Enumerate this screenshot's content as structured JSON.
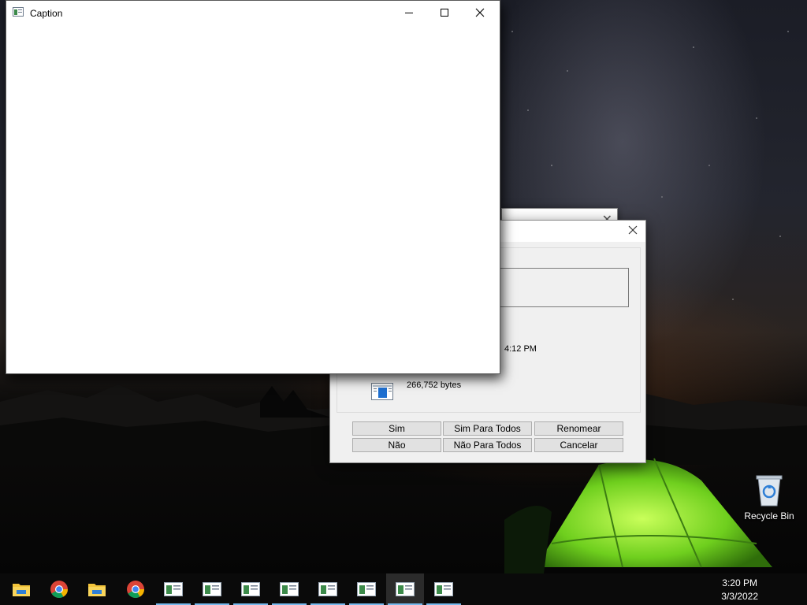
{
  "main_window": {
    "title": "Caption",
    "icons": {
      "app": "window-app-icon",
      "minimize": "minimize-icon",
      "maximize": "maximize-icon",
      "close": "close-icon"
    }
  },
  "dialog": {
    "date_fragment": "4:12 PM",
    "file_size": "266,752 bytes",
    "buttons": {
      "yes": "Sim",
      "yes_to_all": "Sim Para Todos",
      "rename": "Renomear",
      "no": "Não",
      "no_to_all": "Não Para Todos",
      "cancel": "Cancelar"
    }
  },
  "desktop": {
    "recycle_bin_label": "Recycle Bin"
  },
  "taskbar": {
    "items": [
      {
        "icon": "file-explorer-icon"
      },
      {
        "icon": "chrome-icon"
      },
      {
        "icon": "file-explorer-icon"
      },
      {
        "icon": "chrome-icon"
      },
      {
        "icon": "app-window-icon"
      },
      {
        "icon": "app-window-icon"
      },
      {
        "icon": "app-window-icon"
      },
      {
        "icon": "app-window-icon"
      },
      {
        "icon": "app-window-icon"
      },
      {
        "icon": "app-window-icon"
      },
      {
        "icon": "app-window-icon",
        "active": true
      },
      {
        "icon": "app-window-icon"
      }
    ],
    "time": "3:20 PM",
    "date": "3/3/2022"
  },
  "colors": {
    "taskbar_bg": "#0a0a0a",
    "taskbar_accent": "#76b9ed",
    "button_face": "#e1e1e1",
    "dialog_bg": "#f0f0f0"
  }
}
